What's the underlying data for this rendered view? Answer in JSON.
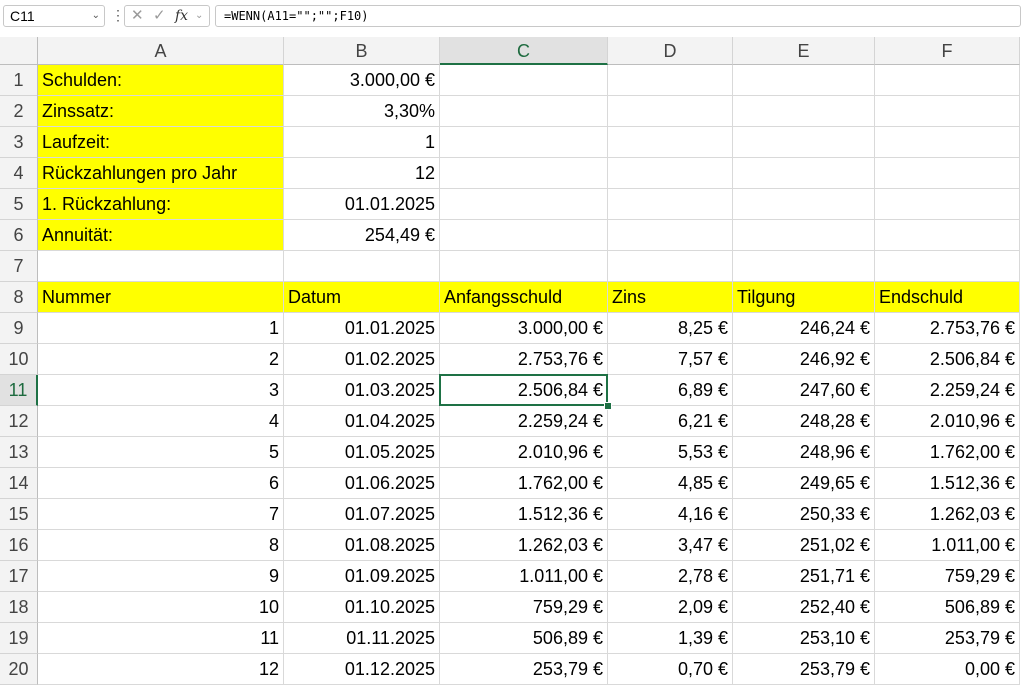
{
  "formula_bar": {
    "name_box": "C11",
    "fx": "fx",
    "formula": "=WENN(A11=\"\";\"\";F10)"
  },
  "grid": {
    "selected_cell": "C11",
    "columns": [
      "A",
      "B",
      "C",
      "D",
      "E",
      "F"
    ],
    "rows": [
      "1",
      "2",
      "3",
      "4",
      "5",
      "6",
      "7",
      "8",
      "9",
      "10",
      "11",
      "12",
      "13",
      "14",
      "15",
      "16",
      "17",
      "18",
      "19",
      "20"
    ],
    "summary": [
      {
        "label": "Schulden:",
        "value": "3.000,00 €"
      },
      {
        "label": "Zinssatz:",
        "value": "3,30%"
      },
      {
        "label": "Laufzeit:",
        "value": "1"
      },
      {
        "label": "Rückzahlungen pro Jahr",
        "value": "12"
      },
      {
        "label": "1. Rückzahlung:",
        "value": "01.01.2025"
      },
      {
        "label": "Annuität:",
        "value": "254,49 €"
      }
    ],
    "table_headers": [
      "Nummer",
      "Datum",
      "Anfangsschuld",
      "Zins",
      "Tilgung",
      "Endschuld"
    ],
    "table_rows": [
      [
        "1",
        "01.01.2025",
        "3.000,00 €",
        "8,25 €",
        "246,24 €",
        "2.753,76 €"
      ],
      [
        "2",
        "01.02.2025",
        "2.753,76 €",
        "7,57 €",
        "246,92 €",
        "2.506,84 €"
      ],
      [
        "3",
        "01.03.2025",
        "2.506,84 €",
        "6,89 €",
        "247,60 €",
        "2.259,24 €"
      ],
      [
        "4",
        "01.04.2025",
        "2.259,24 €",
        "6,21 €",
        "248,28 €",
        "2.010,96 €"
      ],
      [
        "5",
        "01.05.2025",
        "2.010,96 €",
        "5,53 €",
        "248,96 €",
        "1.762,00 €"
      ],
      [
        "6",
        "01.06.2025",
        "1.762,00 €",
        "4,85 €",
        "249,65 €",
        "1.512,36 €"
      ],
      [
        "7",
        "01.07.2025",
        "1.512,36 €",
        "4,16 €",
        "250,33 €",
        "1.262,03 €"
      ],
      [
        "8",
        "01.08.2025",
        "1.262,03 €",
        "3,47 €",
        "251,02 €",
        "1.011,00 €"
      ],
      [
        "9",
        "01.09.2025",
        "1.011,00 €",
        "2,78 €",
        "251,71 €",
        "759,29 €"
      ],
      [
        "10",
        "01.10.2025",
        "759,29 €",
        "2,09 €",
        "252,40 €",
        "506,89 €"
      ],
      [
        "11",
        "01.11.2025",
        "506,89 €",
        "1,39 €",
        "253,10 €",
        "253,79 €"
      ],
      [
        "12",
        "01.12.2025",
        "253,79 €",
        "0,70 €",
        "253,79 €",
        "0,00 €"
      ]
    ]
  },
  "colors": {
    "highlight": "#ffff00",
    "selection": "#1e7145"
  }
}
